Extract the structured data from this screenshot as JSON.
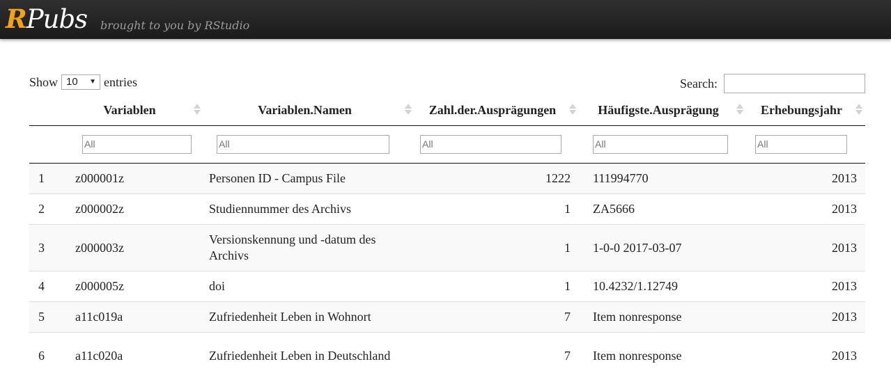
{
  "header": {
    "logo_r": "R",
    "logo_rest": "Pubs",
    "tagline": "brought to you by RStudio"
  },
  "controls": {
    "show_label": "Show",
    "entries_value": "10",
    "entries_label": "entries",
    "search_label": "Search:",
    "search_value": ""
  },
  "table": {
    "columns": [
      "",
      "Variablen",
      "Variablen.Namen",
      "Zahl.der.Ausprägungen",
      "Häufigste.Ausprägung",
      "Erhebungsjahr"
    ],
    "filter_placeholder": "All",
    "rows": [
      {
        "idx": "1",
        "var": "z000001z",
        "name": "Personen ID - Campus File",
        "count": "1222",
        "most": "111994770",
        "year": "2013"
      },
      {
        "idx": "2",
        "var": "z000002z",
        "name": "Studiennummer des Archivs",
        "count": "1",
        "most": "ZA5666",
        "year": "2013"
      },
      {
        "idx": "3",
        "var": "z000003z",
        "name": "Versionskennung und -datum des Archivs",
        "count": "1",
        "most": "1-0-0 2017-03-07",
        "year": "2013"
      },
      {
        "idx": "4",
        "var": "z000005z",
        "name": "doi",
        "count": "1",
        "most": "10.4232/1.12749",
        "year": "2013"
      },
      {
        "idx": "5",
        "var": "a11c019a",
        "name": "Zufriedenheit Leben in Wohnort",
        "count": "7",
        "most": "Item nonresponse",
        "year": "2013"
      },
      {
        "idx": "6",
        "var": "a11c020a",
        "name": "Zufriedenheit Leben in Deutschland",
        "count": "7",
        "most": "Item nonresponse",
        "year": "2013"
      }
    ]
  }
}
